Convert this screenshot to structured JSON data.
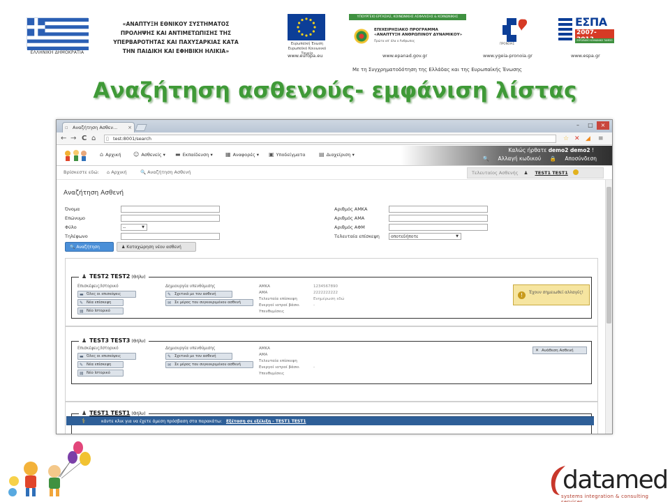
{
  "banner": {
    "gr_caption": "ΕΛΛΗΝΙΚΗ ΔΗΜΟΚΡΑΤΙΑ",
    "agency_lines": [
      "«ΑΝΑΠΤΥΞΗ ΕΘΝΙΚΟΥ ΣΥΣΤΗΜΑΤΟΣ",
      "ΠΡΟΛΗΨΗΣ ΚΑΙ ΑΝΤΙΜΕΤΩΠΙΣΗΣ ΤΗΣ",
      "ΥΠΕΡΒΑΡΟΤΗΤΑΣ ΚΑΙ ΠΑΧΥΣΑΡΚΙΑΣ ΚΑΤΑ",
      "ΤΗΝ ΠΑΙΔΙΚΗ ΚΑΙ ΕΦΗΒΙΚΗ ΗΛΙΚΙΑ»"
    ],
    "eu_caption": "Ευρωπαϊκή Ένωση",
    "eu_subcaption": "Ευρωπαϊκό Κοινωνικό Ταμείο",
    "epana_top": "ΥΠΟΥΡΓΕΙΟ ΕΡΓΑΣΙΑΣ, ΚΟΙΝΩΝΙΚΗΣ ΑΣΦΑΛΙΣΗΣ & ΚΟΙΝΩΝΙΚΗΣ ΑΛΛΗΛΕΓΓΥΗΣ",
    "epana_title": "ΕΠΙΧΕΙΡΗΣΙΑΚΟ ΠΡΟΓΡΑΜΜΑ «ΑΝΑΠΤΥΞΗ ΑΝΘΡΩΠΙΝΟΥ ΔΥΝΑΜΙΚΟΥ»",
    "epana_sub": "Πρώτα απ' όλα ο Άνθρωπος",
    "ygeia_caption": "ΠΡΟΝΟΙΑΣ",
    "espa_word": "ΕΣΠΑ",
    "espa_years": "2007-2013",
    "espa_bar": "ΕΥΡΩΠΑΪΚΟ ΚΟΙΝΩΝΙΚΟ ΤΑΜΕΙΟ",
    "urls": [
      "www.europa.eu",
      "www.epanad.gov.gr",
      "www.ygeia-pronoia.gr",
      "www.espa.gr"
    ],
    "cofund": "Με τη Συγχρηματοδότηση της Ελλάδας και της Ευρωπαϊκής Ένωσης"
  },
  "slide_title": "Αναζήτηση ασθενούς- εμφάνιση λίστας",
  "browser": {
    "tab_title": "Αναζήτηση Ασθεν...",
    "url": "test:8001/search",
    "nav": {
      "back": "←",
      "forward": "→",
      "reload": "C",
      "home": "⌂"
    }
  },
  "app": {
    "menu": [
      {
        "icon": "home",
        "label": "Αρχική"
      },
      {
        "icon": "users",
        "label": "Ασθενείς ▾"
      },
      {
        "icon": "folder",
        "label": "Εκπαίδευση ▾"
      },
      {
        "icon": "chart",
        "label": "Αναφορές ▾"
      },
      {
        "icon": "box",
        "label": "Υποδείγματα"
      },
      {
        "icon": "calendar",
        "label": "Διαχείριση ▾"
      }
    ],
    "welcome_prefix": "Καλώς ήρθατε",
    "welcome_user": "demo2 demo2",
    "change_password": "Αλλαγή κωδικού",
    "logout": "Αποσύνδεση",
    "breadcrumb": [
      "Βρίσκεστε εδώ:",
      "Αρχική",
      "Αναζήτηση Ασθενή"
    ],
    "last_patient_label": "Τελευταίος Ασθενής",
    "last_patient_name": "TEST1 TEST1"
  },
  "form": {
    "title": "Αναζήτηση Ασθενή",
    "left_labels": [
      "Όνομα",
      "Επώνυμο",
      "Φύλο",
      "Τηλέφωνο"
    ],
    "right_labels": [
      "Αριθμός ΑΜΚΑ",
      "Αριθμός ΑΜΑ",
      "Αριθμός ΑΦΜ",
      "Τελευταία επίσκεψη"
    ],
    "gender_value": "--",
    "last_visit_value": "οποτεδήποτε",
    "search_button": "Αναζήτηση",
    "new_patient_button": "Καταχώρηση νέου ασθενή"
  },
  "results": [
    {
      "name": "TEST2 TEST2",
      "tag": "(Θήλυ)",
      "left_col_title": "Επισκέψεις/Ιστορικό",
      "left_buttons": [
        "Όλες οι επισκέψεις",
        "Νέα επίσκεψη",
        "Νέο Ιστορικό"
      ],
      "mid_col_title": "Δημιουργία υπενθύμισης",
      "mid_buttons": [
        "Σχετικά με τον ασθενή",
        "Σε μέρος του συγκεκριμένου ασθενή"
      ],
      "info_labels": [
        "ΑΜΚΑ",
        "ΑΜΑ",
        "Τελευταία επίσκεψη",
        "Ενεργοί ιατροί βάσει",
        "Υπενθυμίσεις"
      ],
      "info_values": [
        "1234567890",
        "2222222222",
        "Ενημέρωση εδώ",
        "-",
        ""
      ],
      "alert": "Έχουν σημειωθεί αλλαγές!"
    },
    {
      "name": "TEST3 TEST3",
      "tag": "(Θήλυ)",
      "left_col_title": "Επισκέψεις/Ιστορικό",
      "left_buttons": [
        "Όλες οι επισκέψεις",
        "Νέα επίσκεψη",
        "Νέο Ιστορικό"
      ],
      "mid_col_title": "Δημιουργία υπενθύμισης",
      "mid_buttons": [
        "Σχετικά με τον ασθενή",
        "Σε μέρος του συγκεκριμένου ασθενή"
      ],
      "info_labels": [
        "ΑΜΚΑ",
        "ΑΜΑ",
        "Τελευταία επίσκεψη",
        "Ενεργοί ιατροί βάσει",
        "Υπενθυμίσεις"
      ],
      "info_values": [
        "",
        "",
        "",
        "-",
        ""
      ],
      "assign_button": "Ανάθεση Ασθενή"
    },
    {
      "name": "TEST1 TEST1",
      "tag": "(Θήλυ)"
    }
  ],
  "notify": {
    "text": "κάντε κλικ για να έχετε άμεση πρόσβαση στα παρακάτω:",
    "link": "Εξέταση σε εξέλιξη - TEST1 TEST1"
  },
  "footer": {
    "datamed_word": "datamed",
    "datamed_tag": "systems integration & consulting services"
  },
  "colors": {
    "title_green": "#3f9a37",
    "primary_blue": "#4a8fd8",
    "notify_blue": "#2e5f98",
    "alert_yellow": "#f6e5a0"
  }
}
